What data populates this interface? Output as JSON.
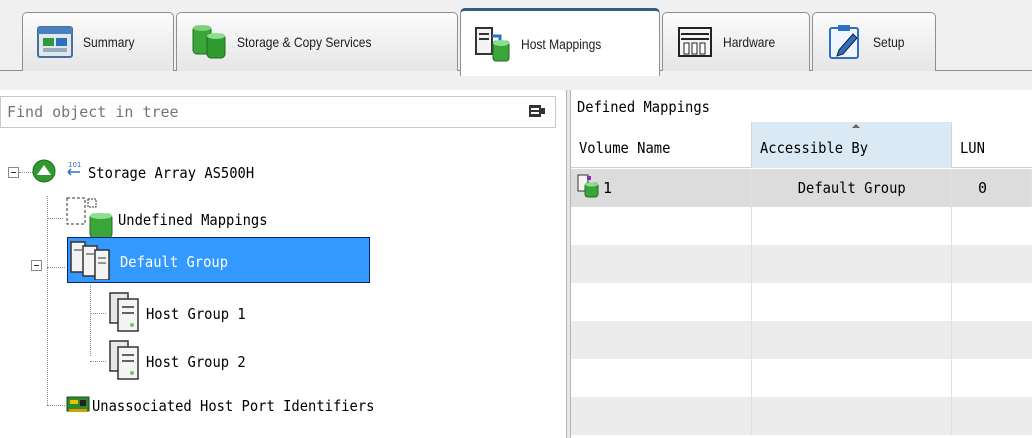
{
  "tabs": [
    {
      "label": "Summary",
      "icon": "summary-icon",
      "active": false
    },
    {
      "label": "Storage & Copy Services",
      "icon": "storage-icon",
      "active": false
    },
    {
      "label": "Host Mappings",
      "icon": "host-mappings-icon",
      "active": true
    },
    {
      "label": "Hardware",
      "icon": "hardware-icon",
      "active": false
    },
    {
      "label": "Setup",
      "icon": "setup-icon",
      "active": false
    }
  ],
  "tree": {
    "search_placeholder": "Find object in tree",
    "root": "Storage Array AS500H",
    "items": [
      {
        "label": "Undefined Mappings"
      },
      {
        "label": "Default Group",
        "selected": true
      },
      {
        "label": "Host Group 1"
      },
      {
        "label": "Host Group 2"
      },
      {
        "label": "Unassociated Host Port Identifiers"
      }
    ]
  },
  "mappings": {
    "title": "Defined Mappings",
    "columns": [
      "Volume Name",
      "Accessible By",
      "LUN"
    ],
    "sorted_column": "Accessible By",
    "rows": [
      {
        "volume": "1",
        "accessible_by": "Default Group",
        "lun": "0"
      }
    ]
  },
  "colors": {
    "selection": "#3399ff",
    "active_tab_accent": "#2c5e8a",
    "sorted_header": "#dbe9f5"
  }
}
